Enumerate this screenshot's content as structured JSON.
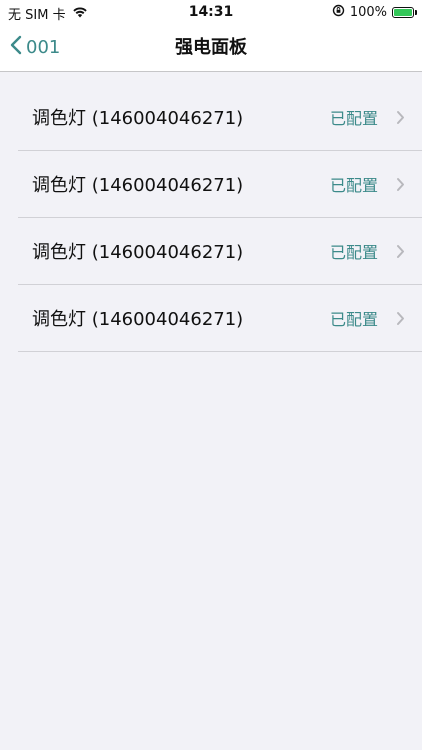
{
  "status_bar": {
    "carrier": "无 SIM 卡",
    "time": "14:31",
    "battery_percent": "100%",
    "icons": [
      "wifi-icon",
      "orientation-lock-icon",
      "battery-charging-icon"
    ]
  },
  "nav": {
    "back_label": "001",
    "title": "强电面板"
  },
  "list": {
    "items": [
      {
        "title": "调色灯 (146004046271)",
        "status": "已配置"
      },
      {
        "title": "调色灯 (146004046271)",
        "status": "已配置"
      },
      {
        "title": "调色灯 (146004046271)",
        "status": "已配置"
      },
      {
        "title": "调色灯 (146004046271)",
        "status": "已配置"
      }
    ]
  },
  "colors": {
    "accent": "#3c8a8a",
    "background": "#f2f2f7",
    "separator": "#d1d1d6",
    "battery": "#34c759"
  }
}
